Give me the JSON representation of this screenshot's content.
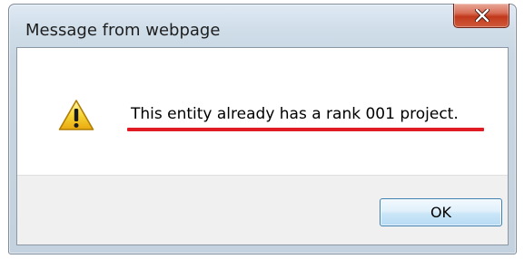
{
  "dialog": {
    "title": "Message from webpage",
    "close_icon": "close-x-icon",
    "message_icon": "warning-icon",
    "message": "This entity already has a rank 001 project.",
    "ok_label": "OK"
  },
  "colors": {
    "annotation_underline": "#e01b24",
    "close_button": "#c2391c",
    "ok_button_border": "#3c7fb1"
  }
}
